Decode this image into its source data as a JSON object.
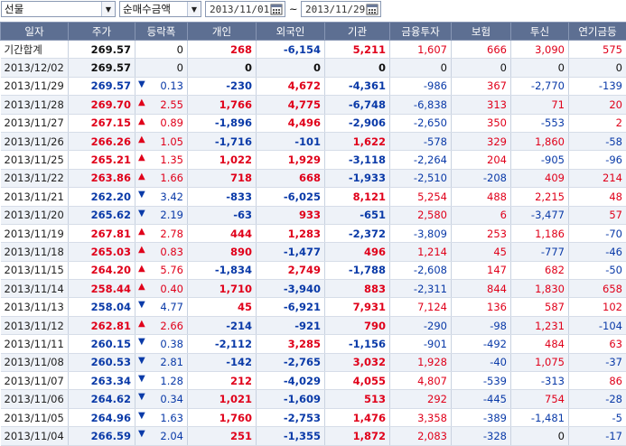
{
  "toolbar": {
    "market_select": "선물",
    "type_select": "순매수금액",
    "start_date": "2013/11/01",
    "end_date": "2013/11/29",
    "range_sep": "~"
  },
  "columns": [
    "일자",
    "주가",
    "등락폭",
    "개인",
    "외국인",
    "기관",
    "금융투자",
    "보험",
    "투신",
    "연기금등"
  ],
  "colors": {
    "up": "#e0001a",
    "down": "#0a3aa8",
    "header": "#5d6f92"
  },
  "rows": [
    {
      "date": "기간합계",
      "close": "269.57",
      "dir": "",
      "chg": "0",
      "ind": "268",
      "frn": "-6,154",
      "inst": "5,211",
      "fin": "1,607",
      "ins": "666",
      "trust": "3,090",
      "pension": "575"
    },
    {
      "date": "2013/12/02",
      "close": "269.57",
      "dir": "",
      "chg": "0",
      "ind": "0",
      "frn": "0",
      "inst": "0",
      "fin": "0",
      "ins": "0",
      "trust": "0",
      "pension": "0"
    },
    {
      "date": "2013/11/29",
      "close": "269.57",
      "dir": "down",
      "chg": "0.13",
      "ind": "-230",
      "frn": "4,672",
      "inst": "-4,361",
      "fin": "-986",
      "ins": "367",
      "trust": "-2,770",
      "pension": "-139"
    },
    {
      "date": "2013/11/28",
      "close": "269.70",
      "dir": "up",
      "chg": "2.55",
      "ind": "1,766",
      "frn": "4,775",
      "inst": "-6,748",
      "fin": "-6,838",
      "ins": "313",
      "trust": "71",
      "pension": "20"
    },
    {
      "date": "2013/11/27",
      "close": "267.15",
      "dir": "up",
      "chg": "0.89",
      "ind": "-1,896",
      "frn": "4,496",
      "inst": "-2,906",
      "fin": "-2,650",
      "ins": "350",
      "trust": "-553",
      "pension": "2"
    },
    {
      "date": "2013/11/26",
      "close": "266.26",
      "dir": "up",
      "chg": "1.05",
      "ind": "-1,716",
      "frn": "-101",
      "inst": "1,622",
      "fin": "-578",
      "ins": "329",
      "trust": "1,860",
      "pension": "-58"
    },
    {
      "date": "2013/11/25",
      "close": "265.21",
      "dir": "up",
      "chg": "1.35",
      "ind": "1,022",
      "frn": "1,929",
      "inst": "-3,118",
      "fin": "-2,264",
      "ins": "204",
      "trust": "-905",
      "pension": "-96"
    },
    {
      "date": "2013/11/22",
      "close": "263.86",
      "dir": "up",
      "chg": "1.66",
      "ind": "718",
      "frn": "668",
      "inst": "-1,933",
      "fin": "-2,510",
      "ins": "-208",
      "trust": "409",
      "pension": "214"
    },
    {
      "date": "2013/11/21",
      "close": "262.20",
      "dir": "down",
      "chg": "3.42",
      "ind": "-833",
      "frn": "-6,025",
      "inst": "8,121",
      "fin": "5,254",
      "ins": "488",
      "trust": "2,215",
      "pension": "48"
    },
    {
      "date": "2013/11/20",
      "close": "265.62",
      "dir": "down",
      "chg": "2.19",
      "ind": "-63",
      "frn": "933",
      "inst": "-651",
      "fin": "2,580",
      "ins": "6",
      "trust": "-3,477",
      "pension": "57"
    },
    {
      "date": "2013/11/19",
      "close": "267.81",
      "dir": "up",
      "chg": "2.78",
      "ind": "444",
      "frn": "1,283",
      "inst": "-2,372",
      "fin": "-3,809",
      "ins": "253",
      "trust": "1,186",
      "pension": "-70"
    },
    {
      "date": "2013/11/18",
      "close": "265.03",
      "dir": "up",
      "chg": "0.83",
      "ind": "890",
      "frn": "-1,477",
      "inst": "496",
      "fin": "1,214",
      "ins": "45",
      "trust": "-777",
      "pension": "-46"
    },
    {
      "date": "2013/11/15",
      "close": "264.20",
      "dir": "up",
      "chg": "5.76",
      "ind": "-1,834",
      "frn": "2,749",
      "inst": "-1,788",
      "fin": "-2,608",
      "ins": "147",
      "trust": "682",
      "pension": "-50"
    },
    {
      "date": "2013/11/14",
      "close": "258.44",
      "dir": "up",
      "chg": "0.40",
      "ind": "1,710",
      "frn": "-3,940",
      "inst": "883",
      "fin": "-2,311",
      "ins": "844",
      "trust": "1,830",
      "pension": "658"
    },
    {
      "date": "2013/11/13",
      "close": "258.04",
      "dir": "down",
      "chg": "4.77",
      "ind": "45",
      "frn": "-6,921",
      "inst": "7,931",
      "fin": "7,124",
      "ins": "136",
      "trust": "587",
      "pension": "102"
    },
    {
      "date": "2013/11/12",
      "close": "262.81",
      "dir": "up",
      "chg": "2.66",
      "ind": "-214",
      "frn": "-921",
      "inst": "790",
      "fin": "-290",
      "ins": "-98",
      "trust": "1,231",
      "pension": "-104"
    },
    {
      "date": "2013/11/11",
      "close": "260.15",
      "dir": "down",
      "chg": "0.38",
      "ind": "-2,112",
      "frn": "3,285",
      "inst": "-1,156",
      "fin": "-901",
      "ins": "-492",
      "trust": "484",
      "pension": "63"
    },
    {
      "date": "2013/11/08",
      "close": "260.53",
      "dir": "down",
      "chg": "2.81",
      "ind": "-142",
      "frn": "-2,765",
      "inst": "3,032",
      "fin": "1,928",
      "ins": "-40",
      "trust": "1,075",
      "pension": "-37"
    },
    {
      "date": "2013/11/07",
      "close": "263.34",
      "dir": "down",
      "chg": "1.28",
      "ind": "212",
      "frn": "-4,029",
      "inst": "4,055",
      "fin": "4,807",
      "ins": "-539",
      "trust": "-313",
      "pension": "86"
    },
    {
      "date": "2013/11/06",
      "close": "264.62",
      "dir": "down",
      "chg": "0.34",
      "ind": "1,021",
      "frn": "-1,609",
      "inst": "513",
      "fin": "292",
      "ins": "-445",
      "trust": "754",
      "pension": "-28"
    },
    {
      "date": "2013/11/05",
      "close": "264.96",
      "dir": "down",
      "chg": "1.63",
      "ind": "1,760",
      "frn": "-2,753",
      "inst": "1,476",
      "fin": "3,358",
      "ins": "-389",
      "trust": "-1,481",
      "pension": "-5"
    },
    {
      "date": "2013/11/04",
      "close": "266.59",
      "dir": "down",
      "chg": "2.04",
      "ind": "251",
      "frn": "-1,355",
      "inst": "1,872",
      "fin": "2,083",
      "ins": "-328",
      "trust": "0",
      "pension": "-17"
    }
  ]
}
